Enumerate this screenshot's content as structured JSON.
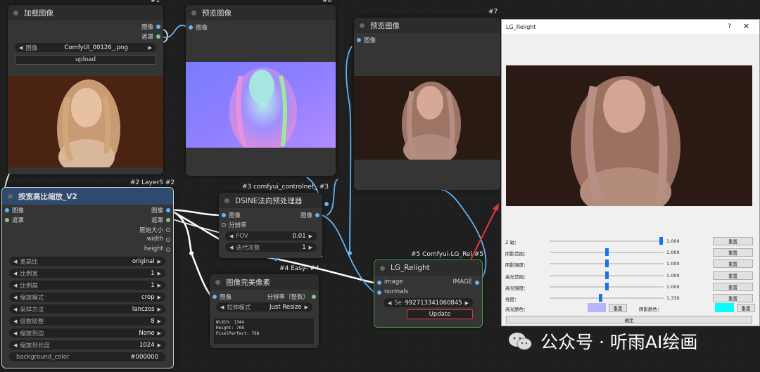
{
  "colors": {
    "image": "#64b5f6",
    "mask": "#81c784",
    "accent_red": "#e53935",
    "green_border": "#43a047",
    "layer_header": "#2e4a6e",
    "cyan": "#00ffff",
    "lavender": "#b4b4ff"
  },
  "n1": {
    "id": "#1",
    "title": "加载图像",
    "out_image": "图像",
    "out_mask": "遮罩",
    "w_image_label": "图像",
    "w_image_value": "ComfyUI_00126_.png",
    "upload": "upload"
  },
  "n6": {
    "id": "#6",
    "title": "预览图像",
    "in_image": "图像"
  },
  "n7": {
    "id": "#7",
    "title": "预览图像",
    "in_image": "图像"
  },
  "n2": {
    "id": "#2 LayerS  #2",
    "title": "按宽高比缩放_V2",
    "in_image": "图像",
    "in_mask": "遮罩",
    "out_image": "图像",
    "out_mask": "遮罩",
    "out_orig": "原始大小",
    "out_width": "width",
    "out_height": "height",
    "widgets": [
      {
        "label": "宽高比",
        "value": "original"
      },
      {
        "label": "比例宽",
        "value": "1"
      },
      {
        "label": "比例高",
        "value": "1"
      },
      {
        "label": "缩放模式",
        "value": "crop"
      },
      {
        "label": "采样方法",
        "value": "lanczos"
      },
      {
        "label": "倍数取整",
        "value": "8"
      },
      {
        "label": "缩放到边",
        "value": "None"
      },
      {
        "label": "缩放到长度",
        "value": "1024"
      },
      {
        "label": "background_color",
        "value": "#000000"
      }
    ]
  },
  "n3": {
    "id": "#3 comfyui_controlnet_  #3",
    "title": "DSINE法向预处理器",
    "in_image": "图像",
    "out_image": "图像",
    "in_res": "分辨率",
    "w_fov_label": "FOV",
    "w_fov_value": "0.01",
    "w_iter_label": "迭代次数",
    "w_iter_value": "1"
  },
  "n4": {
    "id": "#4 Easy-  #4",
    "title": "图像完美像素",
    "in_image": "图像",
    "out_res": "分辨率（整数）",
    "w_mode_label": "拉伸模式",
    "w_mode_value": "Just Resize",
    "text": [
      "Width: 1344",
      "Height: 768",
      "PixelPerfect: 768"
    ]
  },
  "n5": {
    "id": "#5 Comfyui-LG_Rel  #5",
    "title": "LG_Relight",
    "in_image": "image",
    "in_normals": "normals",
    "out_image": "IMAGE",
    "w_seed_label": "Se",
    "w_seed_value": "992713341060845",
    "update": "Update"
  },
  "dialog": {
    "title": "LG_Relight",
    "help": "?",
    "close": "✕",
    "rows": [
      {
        "label": "Z 轴：",
        "value": "1.000",
        "reset": "重置",
        "pos": 0.99
      },
      {
        "label": "阴影范围：",
        "value": "1.000",
        "reset": "重置",
        "pos": 0.5
      },
      {
        "label": "阴影强度：",
        "value": "1.000",
        "reset": "重置",
        "pos": 0.5
      },
      {
        "label": "高光范围：",
        "value": "1.000",
        "reset": "重置",
        "pos": 0.5
      },
      {
        "label": "高光强度：",
        "value": "1.000",
        "reset": "重置",
        "pos": 0.5
      },
      {
        "label": "亮度：",
        "value": "1.330",
        "reset": "重置",
        "pos": 0.44
      }
    ],
    "hl_color_label": "高光颜色：",
    "hl_reset": "重置",
    "sh_color_label": "阴影颜色：",
    "sh_reset": "重置",
    "confirm": "确定"
  },
  "watermark": "公众号 · 听雨AI绘画"
}
